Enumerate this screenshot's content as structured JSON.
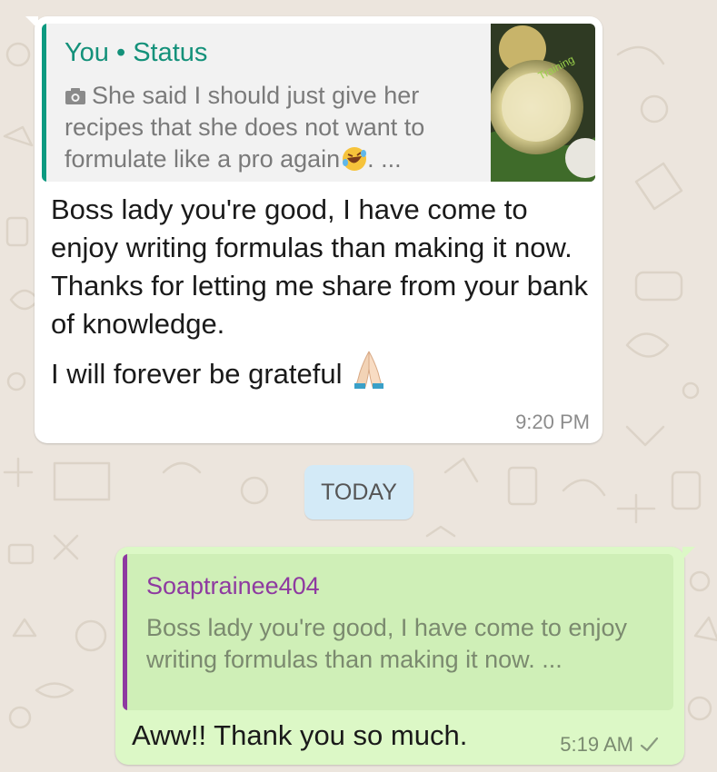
{
  "incoming": {
    "quote": {
      "author": "You • Status",
      "text": "She said I should just give her recipes  that she does not want to formulate like a pro again",
      "ellipsis": ". ...",
      "thumbnail_caption": "Training",
      "icon": "camera-icon",
      "emoji": "rolling-laughing-emoji"
    },
    "body": {
      "line1": "Boss lady you're good, I have come to enjoy writing formulas than making it now.",
      "line2": "Thanks for letting me share from your bank of knowledge.",
      "line3": "I will forever be grateful",
      "emoji": "folded-hands-emoji"
    },
    "time": "9:20 PM"
  },
  "date_chip": "TODAY",
  "outgoing": {
    "quote": {
      "author": "Soaptrainee404",
      "text": "Boss lady you're good, I have come to enjoy writing formulas than making it now. ..."
    },
    "text": "Aww!! Thank you so much.",
    "time": "5:19 AM",
    "status_icon": "single-check-icon"
  },
  "colors": {
    "background": "#ece5dd",
    "incoming_bubble": "#ffffff",
    "outgoing_bubble": "#dcf8c6",
    "status_author": "#14917a",
    "reply_author": "#8e3aa0",
    "date_chip": "#d3eaf7"
  }
}
